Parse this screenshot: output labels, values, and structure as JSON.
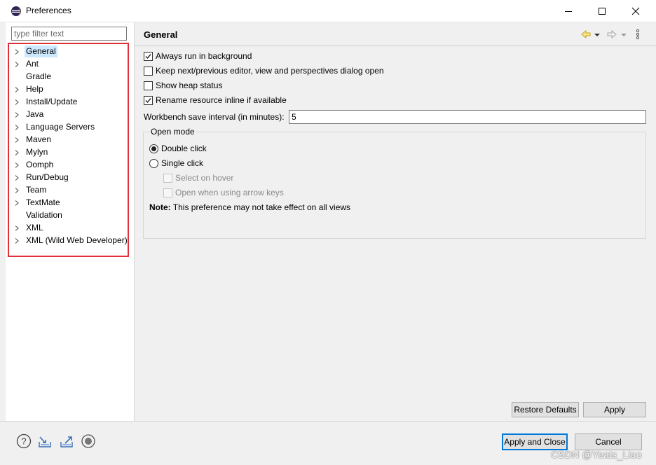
{
  "window": {
    "title": "Preferences",
    "app_icon": "eclipse-icon",
    "controls": [
      "minimize-icon",
      "maximize-icon",
      "close-icon"
    ]
  },
  "left_pane": {
    "filter": {
      "placeholder": "type filter text",
      "value": ""
    },
    "highlight_color": "#e0303a",
    "tree": [
      {
        "label": "General",
        "expandable": true,
        "selected": true
      },
      {
        "label": "Ant",
        "expandable": true
      },
      {
        "label": "Gradle",
        "expandable": false
      },
      {
        "label": "Help",
        "expandable": true
      },
      {
        "label": "Install/Update",
        "expandable": true
      },
      {
        "label": "Java",
        "expandable": true
      },
      {
        "label": "Language Servers",
        "expandable": true
      },
      {
        "label": "Maven",
        "expandable": true
      },
      {
        "label": "Mylyn",
        "expandable": true
      },
      {
        "label": "Oomph",
        "expandable": true
      },
      {
        "label": "Run/Debug",
        "expandable": true
      },
      {
        "label": "Team",
        "expandable": true
      },
      {
        "label": "TextMate",
        "expandable": true
      },
      {
        "label": "Validation",
        "expandable": false
      },
      {
        "label": "XML",
        "expandable": true
      },
      {
        "label": "XML (Wild Web Developer)",
        "expandable": true
      }
    ]
  },
  "page": {
    "title": "General",
    "nav_icons": [
      "back-arrow-icon",
      "dropdown-icon",
      "forward-arrow-icon",
      "dropdown-icon",
      "view-menu-icon"
    ],
    "checkboxes": [
      {
        "label": "Always run in background",
        "checked": true
      },
      {
        "label": "Keep next/previous editor, view and perspectives dialog open",
        "checked": false
      },
      {
        "label": "Show heap status",
        "checked": false
      },
      {
        "label": "Rename resource inline if available",
        "checked": true
      }
    ],
    "save_interval": {
      "label": "Workbench save interval (in minutes):",
      "value": "5"
    },
    "open_mode": {
      "title": "Open mode",
      "double_click": "Double click",
      "single_click": "Single click",
      "selected": "Double click",
      "select_on_hover": "Select on hover",
      "open_arrow_keys": "Open when using arrow keys",
      "note_label": "Note:",
      "note_text": "This preference may not take effect on all views"
    },
    "restore_defaults": "Restore Defaults",
    "apply": "Apply"
  },
  "bottom": {
    "icons": [
      "help-icon",
      "import-icon",
      "export-icon",
      "record-icon"
    ],
    "apply_and_close": "Apply and Close",
    "cancel": "Cancel",
    "watermark": "CSDN @Yeats_Liao"
  }
}
